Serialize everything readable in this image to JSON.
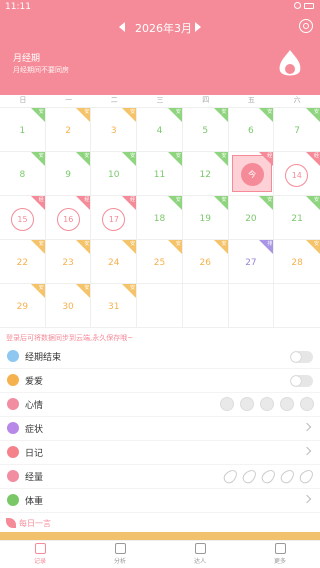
{
  "status": {
    "time": "11:11"
  },
  "header": {
    "month": "2026年3月",
    "title": "月经期",
    "subtitle": "月经期间不要同房"
  },
  "weekdays": [
    "日",
    "一",
    "二",
    "三",
    "四",
    "五",
    "六"
  ],
  "calendar": [
    {
      "day": "1",
      "color": "green",
      "tag": "安"
    },
    {
      "day": "2",
      "color": "orange",
      "tag": "安"
    },
    {
      "day": "3",
      "color": "orange",
      "tag": "安"
    },
    {
      "day": "4",
      "color": "green",
      "tag": "安"
    },
    {
      "day": "5",
      "color": "green",
      "tag": "安"
    },
    {
      "day": "6",
      "color": "green",
      "tag": "安"
    },
    {
      "day": "7",
      "color": "green",
      "tag": "安"
    },
    {
      "day": "8",
      "color": "green",
      "tag": "安"
    },
    {
      "day": "9",
      "color": "green",
      "tag": "安"
    },
    {
      "day": "10",
      "color": "green",
      "tag": "安"
    },
    {
      "day": "11",
      "color": "green",
      "tag": "安"
    },
    {
      "day": "12",
      "color": "green",
      "tag": "安"
    },
    {
      "day": "今",
      "color": "pink",
      "tag": "经",
      "today": true
    },
    {
      "day": "14",
      "color": "pink",
      "tag": "经",
      "circle": true
    },
    {
      "day": "15",
      "color": "pink",
      "tag": "经",
      "circle": true
    },
    {
      "day": "16",
      "color": "pink",
      "tag": "经",
      "circle": true
    },
    {
      "day": "17",
      "color": "pink",
      "tag": "经",
      "circle": true
    },
    {
      "day": "18",
      "color": "green",
      "tag": "安"
    },
    {
      "day": "19",
      "color": "green",
      "tag": "安"
    },
    {
      "day": "20",
      "color": "green",
      "tag": "安"
    },
    {
      "day": "21",
      "color": "green",
      "tag": "安"
    },
    {
      "day": "22",
      "color": "orange",
      "tag": "安"
    },
    {
      "day": "23",
      "color": "orange",
      "tag": "安"
    },
    {
      "day": "24",
      "color": "orange",
      "tag": "安"
    },
    {
      "day": "25",
      "color": "orange",
      "tag": "安"
    },
    {
      "day": "26",
      "color": "orange",
      "tag": "安"
    },
    {
      "day": "27",
      "color": "purple",
      "tag": "排"
    },
    {
      "day": "28",
      "color": "orange",
      "tag": "安"
    },
    {
      "day": "29",
      "color": "orange",
      "tag": "安"
    },
    {
      "day": "30",
      "color": "orange",
      "tag": "安"
    },
    {
      "day": "31",
      "color": "orange",
      "tag": "安"
    },
    {
      "day": "",
      "color": "",
      "tag": ""
    },
    {
      "day": "",
      "color": "",
      "tag": ""
    },
    {
      "day": "",
      "color": "",
      "tag": ""
    },
    {
      "day": "",
      "color": "",
      "tag": ""
    }
  ],
  "sync_tip": "登录后可将数据同步到云端,永久保存哦~",
  "records": [
    {
      "label": "经期结束",
      "type": "toggle",
      "color": "#8ec7f0"
    },
    {
      "label": "爱爱",
      "type": "toggle",
      "color": "#f5b14e"
    },
    {
      "label": "心情",
      "type": "faces",
      "color": "#f28da0"
    },
    {
      "label": "症状",
      "type": "chevron",
      "color": "#b888e8"
    },
    {
      "label": "日记",
      "type": "chevron",
      "color": "#f5828b"
    },
    {
      "label": "经量",
      "type": "drops",
      "color": "#f28da0"
    },
    {
      "label": "体重",
      "type": "chevron",
      "color": "#7ac768"
    }
  ],
  "daily": {
    "title": "每日一言"
  },
  "nav": [
    {
      "label": "记录",
      "active": true
    },
    {
      "label": "分析"
    },
    {
      "label": "达人"
    },
    {
      "label": "更多"
    }
  ]
}
